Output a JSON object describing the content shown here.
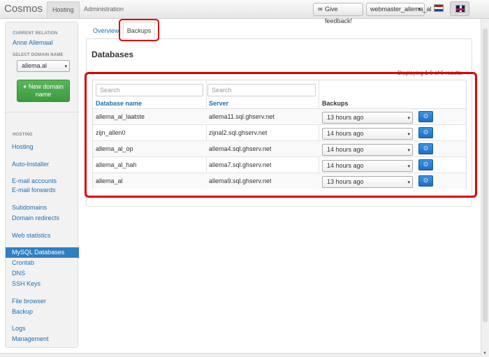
{
  "app": {
    "brand": "Cosmos",
    "top_tab": "Hosting",
    "top_link": "Administration",
    "feedback_label": "Give feedback!",
    "user_label": "webmaster_allema_al"
  },
  "sidebar": {
    "current_relation_heading": "CURRENT RELATION",
    "relation_name": "Anne Allemaal",
    "select_domain_heading": "SELECT DOMAIN NAME",
    "domain_value": "allema.al",
    "new_domain_button": "New domain name",
    "hosting_heading": "HOSTING",
    "items": [
      {
        "label": "Hosting",
        "active": false
      },
      {
        "label": "Auto-Installer",
        "active": false
      },
      {
        "label": "E-mail accounts",
        "active": false
      },
      {
        "label": "E-mail forwards",
        "active": false
      },
      {
        "label": "Subdomains",
        "active": false
      },
      {
        "label": "Domain redirects",
        "active": false
      },
      {
        "label": "Web statistics",
        "active": false
      },
      {
        "label": "MySQL Databases",
        "active": true
      },
      {
        "label": "Crontab",
        "active": false
      },
      {
        "label": "DNS",
        "active": false
      },
      {
        "label": "SSH Keys",
        "active": false
      },
      {
        "label": "File browser",
        "active": false
      },
      {
        "label": "Backup",
        "active": false
      },
      {
        "label": "Logs",
        "active": false
      },
      {
        "label": "Management",
        "active": false
      }
    ]
  },
  "main": {
    "tabs": [
      {
        "label": "Overview",
        "active": false
      },
      {
        "label": "Backups",
        "active": true
      }
    ],
    "section_title": "Databases",
    "display_text": "Displaying 1-5 of 5 results.",
    "search_placeholder_1": "Search",
    "search_placeholder_2": "Search",
    "columns": [
      "Database name",
      "Server",
      "Backups"
    ],
    "rows": [
      {
        "db": "allema_al_laatste",
        "server": "allema11.sql.ghserv.net",
        "backup": "13 hours ago"
      },
      {
        "db": "zijn_allen0",
        "server": "zijnal2.sql.ghserv.net",
        "backup": "14 hours ago"
      },
      {
        "db": "allema_al_op",
        "server": "allema4.sql.ghserv.net",
        "backup": "14 hours ago"
      },
      {
        "db": "allema_al_hah",
        "server": "allema7.sql.ghserv.net",
        "backup": "14 hours ago"
      },
      {
        "db": "allema_al",
        "server": "allema9.sql.ghserv.net",
        "backup": "13 hours ago"
      }
    ]
  },
  "icons": {
    "restore_button_glyph": "⊙",
    "feedback_glyph": "✉",
    "caret_glyph": "▾",
    "plus_glyph": "+"
  },
  "colors": {
    "accent_blue": "#1a6fb5",
    "active_item": "#2f7fc1",
    "new_domain_green": "#4aa84c",
    "highlight_red": "#e00000"
  }
}
